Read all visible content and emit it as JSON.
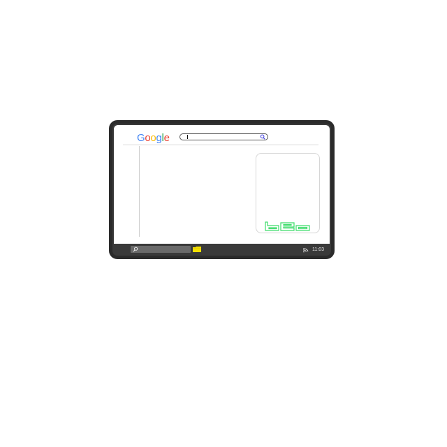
{
  "browser": {
    "logo_text": "Google",
    "logo_letters": [
      {
        "char": "G",
        "color": "#4285F4"
      },
      {
        "char": "o",
        "color": "#EA4335"
      },
      {
        "char": "o",
        "color": "#FBBC05"
      },
      {
        "char": "g",
        "color": "#4285F4"
      },
      {
        "char": "l",
        "color": "#34A853"
      },
      {
        "char": "e",
        "color": "#EA4335"
      }
    ],
    "search": {
      "value": "",
      "icon": "search-icon",
      "accent": "#4a4adf"
    }
  },
  "card": {
    "logo_icon": "green-outline-logo-icon",
    "logo_color": "#3ddc6a"
  },
  "taskbar": {
    "search_icon": "search-icon",
    "folder_icon": "folder-icon",
    "folder_color": "#f5e000",
    "wifi_icon": "wifi-icon",
    "clock": "11:03"
  }
}
